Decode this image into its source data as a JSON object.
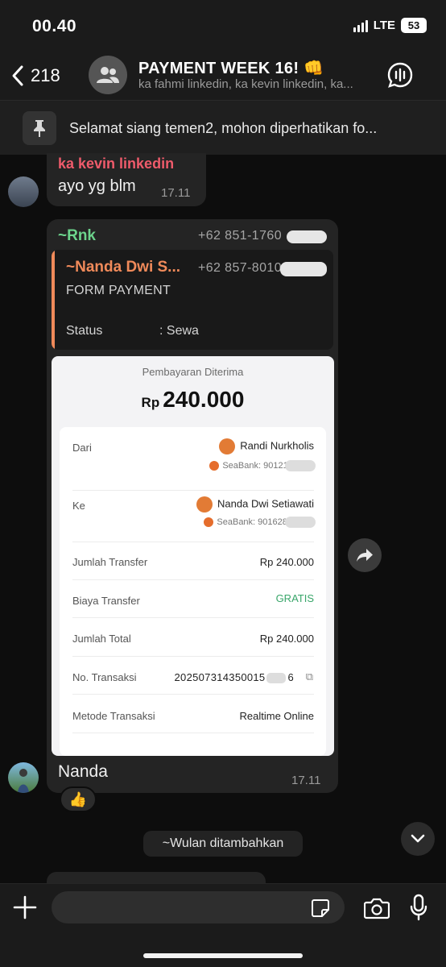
{
  "status_bar": {
    "time": "00.40",
    "network": "LTE",
    "battery": "53"
  },
  "header": {
    "back_count": "218",
    "title": "PAYMENT WEEK 16! 👊",
    "subtitle": "ka fahmi linkedin, ka kevin linkedin, ka..."
  },
  "pinned": {
    "text": "Selamat siang temen2, mohon diperhatikan fo..."
  },
  "messages": [
    {
      "sender": "ka kevin linkedin",
      "text": "ayo yg blm",
      "time": "17.11"
    },
    {
      "sender": "~Rnk",
      "phone": "+62 851-1760",
      "quote": {
        "sender": "~Nanda Dwi S...",
        "phone": "+62 857-8010",
        "line1": "FORM PAYMENT",
        "status_label": "Status",
        "status_value": ": Sewa"
      },
      "receipt": {
        "title": "Pembayaran Diterima",
        "currency": "Rp",
        "amount": "240.000",
        "from_label": "Dari",
        "from_name": "Randi Nurkholis",
        "from_bank": "SeaBank: 901211",
        "to_label": "Ke",
        "to_name": "Nanda Dwi Setiawati",
        "to_bank": "SeaBank: 9016283",
        "rows": [
          {
            "label": "Jumlah Transfer",
            "value": "Rp 240.000"
          },
          {
            "label": "Biaya Transfer",
            "value": "GRATIS"
          },
          {
            "label": "Jumlah Total",
            "value": "Rp 240.000"
          },
          {
            "label": "No. Transaksi",
            "value": "202507314350015",
            "value_end": "6"
          },
          {
            "label": "Metode Transaksi",
            "value": "Realtime Online"
          }
        ]
      },
      "caption": "Nanda",
      "time": "17.11",
      "reaction": "👍"
    }
  ],
  "system_message": "~Wulan ditambahkan",
  "input": {
    "placeholder": ""
  },
  "colors": {
    "sender_red": "#ef5b6b",
    "sender_green": "#6cd48c",
    "quote_orange": "#f08a5a",
    "gratis_green": "#39a66a"
  }
}
